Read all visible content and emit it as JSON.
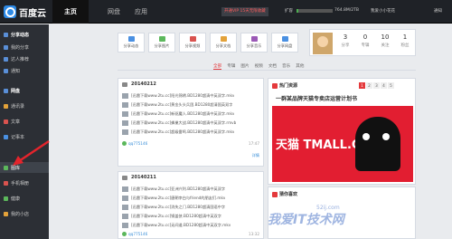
{
  "header": {
    "logo": "百度云",
    "tabs": [
      "主页",
      "网盘",
      "应用"
    ],
    "vip": "开通VIP 15天无限收藏",
    "capacity_label": "扩容",
    "capacity": "764.8M/2TB",
    "capacity_fraction": 0.04,
    "user": "我爱小小花花",
    "links": [
      "通知"
    ]
  },
  "sidebar": {
    "items": [
      {
        "label": "分享动态",
        "bold": true
      },
      {
        "label": "我的分享"
      },
      {
        "label": "达人推荐"
      },
      {
        "label": "通知"
      },
      {
        "label": "网盘"
      },
      {
        "label": "通讯录"
      },
      {
        "label": "文章"
      },
      {
        "label": "记事本"
      },
      {
        "label": "图库"
      },
      {
        "label": "手机相册"
      },
      {
        "label": "健康"
      },
      {
        "label": "我的小店"
      }
    ]
  },
  "quick": [
    "分享动态",
    "分享图片",
    "分享视频",
    "分享文档",
    "分享音乐",
    "分享网盘"
  ],
  "profile": {
    "stats": [
      {
        "n": "3",
        "l": "分享"
      },
      {
        "n": "0",
        "l": "专辑"
      },
      {
        "n": "10",
        "l": "关注"
      },
      {
        "n": "1",
        "l": "粉丝"
      }
    ]
  },
  "filters": [
    "全部",
    "专辑",
    "图片",
    "视频",
    "文档",
    "音乐",
    "其他"
  ],
  "cards": [
    {
      "date": "20140212",
      "files": [
        "[迅雷下载www.2tu.cc]阳光锦绣.BD1280超清中英双字.mkv",
        "[迅雷下载www.2tu.cc]黄金头头兵团.BD1280超清国英双字",
        "[迅雷下载www.2tu.cc]新驱魔人.BD1280超清中英双字.mkv",
        "[迅雷下载www.2tu.cc]蜂巢大战.BD1280超清中英双字.rmvb",
        "[迅雷下载www.2tu.cc]超级雷鸣.BD1280超清中英双字.mkv"
      ],
      "user": "qq775146",
      "time": "17:47",
      "more": "详情"
    },
    {
      "date": "20140211",
      "files": [
        "[迅雷下载www.2tu.cc]亚洲兴利.BD1280超清中英双字",
        "[迅雷下载www.2tu.cc]唐朝李白与friend的朋友们.mkv",
        "[迅雷下载www.2tu.cc]消失之门.BD1280超清国语中字",
        "[迅雷下载www.2tu.cc]锅盖侠.BD1280超清中英双字",
        "[迅雷下载www.2tu.cc]无间道.BD1280超清中英双字.mkv"
      ],
      "user": "qq775146",
      "time": "13:32",
      "more": "详情"
    }
  ],
  "promo": {
    "title": "热门资源",
    "headline": "一群某品牌天猫专卖店运营计划书",
    "pages": [
      "1",
      "2",
      "3",
      "4",
      "5"
    ],
    "banner_text": "天猫 TMALL.COM"
  },
  "recommend": {
    "title": "猜你喜欢"
  },
  "watermark": {
    "main": "我爱IT技术网",
    "sub": "52ij.com"
  },
  "colors": {
    "accent": "#e4393c",
    "topbar": "#1f2227",
    "sidebar": "#2c2f35"
  }
}
